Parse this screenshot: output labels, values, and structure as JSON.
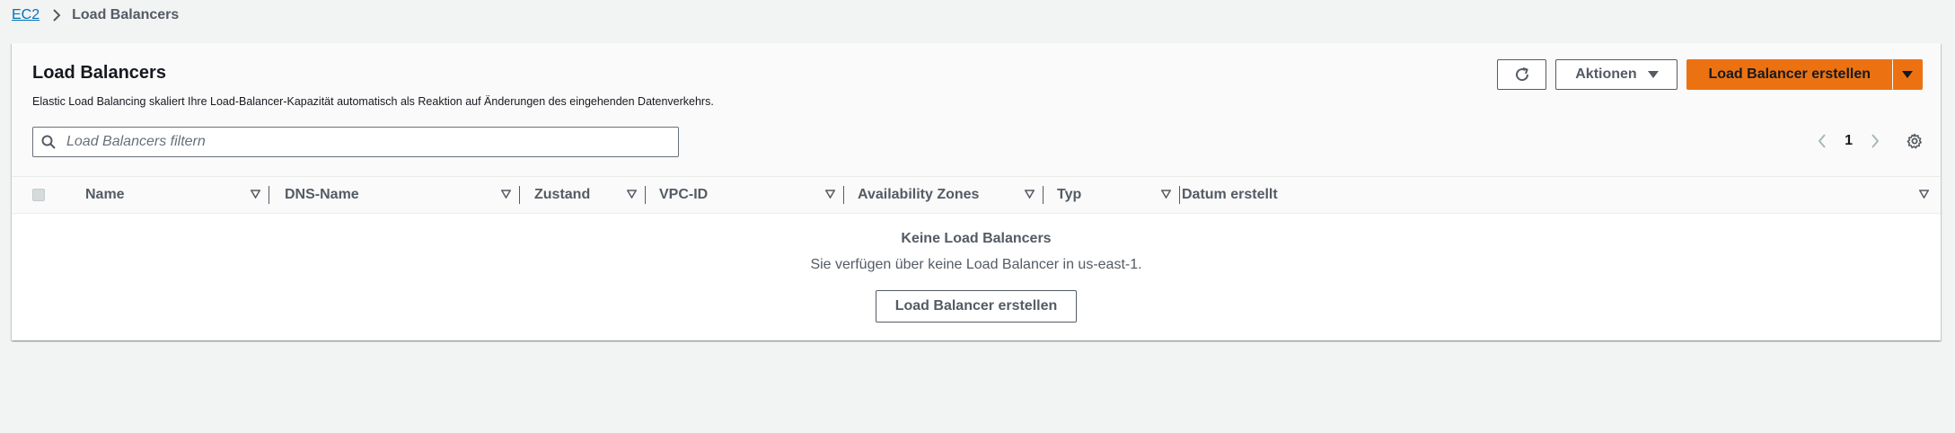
{
  "breadcrumb": {
    "root": "EC2",
    "current": "Load Balancers"
  },
  "header": {
    "title": "Load Balancers",
    "description": "Elastic Load Balancing skaliert Ihre Load-Balancer-Kapazität automatisch als Reaktion auf Änderungen des eingehenden Datenverkehrs.",
    "refresh_icon": "refresh-icon",
    "actions_label": "Aktionen",
    "create_label": "Load Balancer erstellen"
  },
  "filter": {
    "placeholder": "Load Balancers filtern"
  },
  "pagination": {
    "current_page": "1"
  },
  "table": {
    "columns": [
      "Name",
      "DNS-Name",
      "Zustand",
      "VPC-ID",
      "Availability Zones",
      "Typ",
      "Datum erstellt"
    ]
  },
  "empty_state": {
    "title": "Keine Load Balancers",
    "message": "Sie verfügen über keine Load Balancer in us-east-1.",
    "button_label": "Load Balancer erstellen"
  },
  "colors": {
    "primary": "#ec7211",
    "link": "#0073bb",
    "background": "#f2f3f3"
  }
}
